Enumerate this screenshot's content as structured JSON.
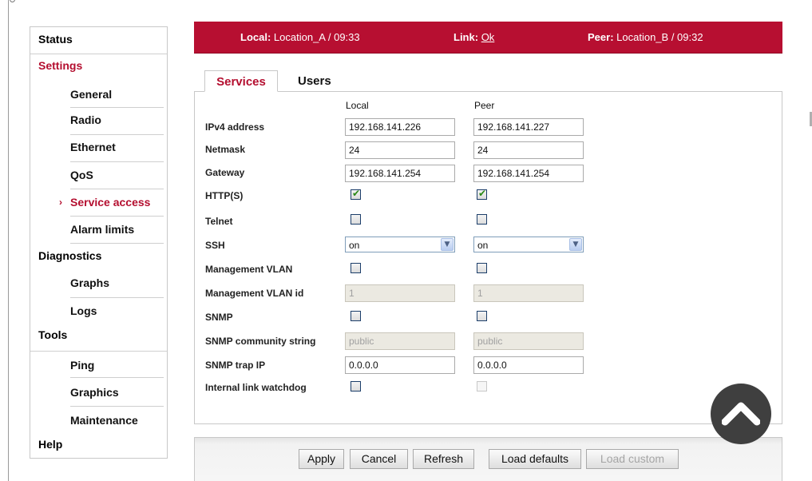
{
  "sidebar": {
    "items": [
      {
        "label": "Status",
        "type": "top"
      },
      {
        "label": "Settings",
        "type": "top",
        "active": true
      },
      {
        "label": "General",
        "type": "sub"
      },
      {
        "label": "Radio",
        "type": "sub"
      },
      {
        "label": "Ethernet",
        "type": "sub"
      },
      {
        "label": "QoS",
        "type": "sub"
      },
      {
        "label": "Service access",
        "type": "sub",
        "current": true,
        "marker": "›"
      },
      {
        "label": "Alarm limits",
        "type": "sub"
      },
      {
        "label": "Diagnostics",
        "type": "top"
      },
      {
        "label": "Graphs",
        "type": "sub"
      },
      {
        "label": "Logs",
        "type": "sub"
      },
      {
        "label": "Tools",
        "type": "top"
      },
      {
        "label": "Ping",
        "type": "sub"
      },
      {
        "label": "Graphics",
        "type": "sub"
      },
      {
        "label": "Maintenance",
        "type": "sub"
      },
      {
        "label": "Help",
        "type": "top"
      }
    ]
  },
  "banner": {
    "local_label": "Local:",
    "local_value": "Location_A / 09:33",
    "link_label": "Link:",
    "link_value": "Ok",
    "peer_label": "Peer:",
    "peer_value": "Location_B / 09:32"
  },
  "tabs": [
    {
      "label": "Services",
      "active": true
    },
    {
      "label": "Users",
      "active": false
    }
  ],
  "columns": {
    "local": "Local",
    "peer": "Peer"
  },
  "form": {
    "ipv4": {
      "label": "IPv4 address",
      "local": "192.168.141.226",
      "peer": "192.168.141.227"
    },
    "netmask": {
      "label": "Netmask",
      "local": "24",
      "peer": "24"
    },
    "gateway": {
      "label": "Gateway",
      "local": "192.168.141.254",
      "peer": "192.168.141.254"
    },
    "http": {
      "label": "HTTP(S)",
      "local": true,
      "peer": true
    },
    "telnet": {
      "label": "Telnet",
      "local": false,
      "peer": false
    },
    "ssh": {
      "label": "SSH",
      "local": "on",
      "peer": "on"
    },
    "mgmt_vlan": {
      "label": "Management VLAN",
      "local": false,
      "peer": false
    },
    "mgmt_vlan_id": {
      "label": "Management VLAN id",
      "local": "1",
      "peer": "1"
    },
    "snmp": {
      "label": "SNMP",
      "local": false,
      "peer": false
    },
    "snmp_community": {
      "label": "SNMP community string",
      "local": "public",
      "peer": "public"
    },
    "snmp_trap": {
      "label": "SNMP trap IP",
      "local": "0.0.0.0",
      "peer": "0.0.0.0"
    },
    "watchdog": {
      "label": "Internal link watchdog",
      "local": false,
      "peer": false
    }
  },
  "buttons": {
    "apply": "Apply",
    "cancel": "Cancel",
    "refresh": "Refresh",
    "load_defaults": "Load defaults",
    "load_custom": "Load custom"
  },
  "colors": {
    "brand": "#b70f31",
    "active_text": "#b40e2f"
  },
  "icons": {
    "scroll_top": "chevron-up-icon",
    "checkmark": "checkmark-icon",
    "dropdown": "chevron-down-icon"
  }
}
